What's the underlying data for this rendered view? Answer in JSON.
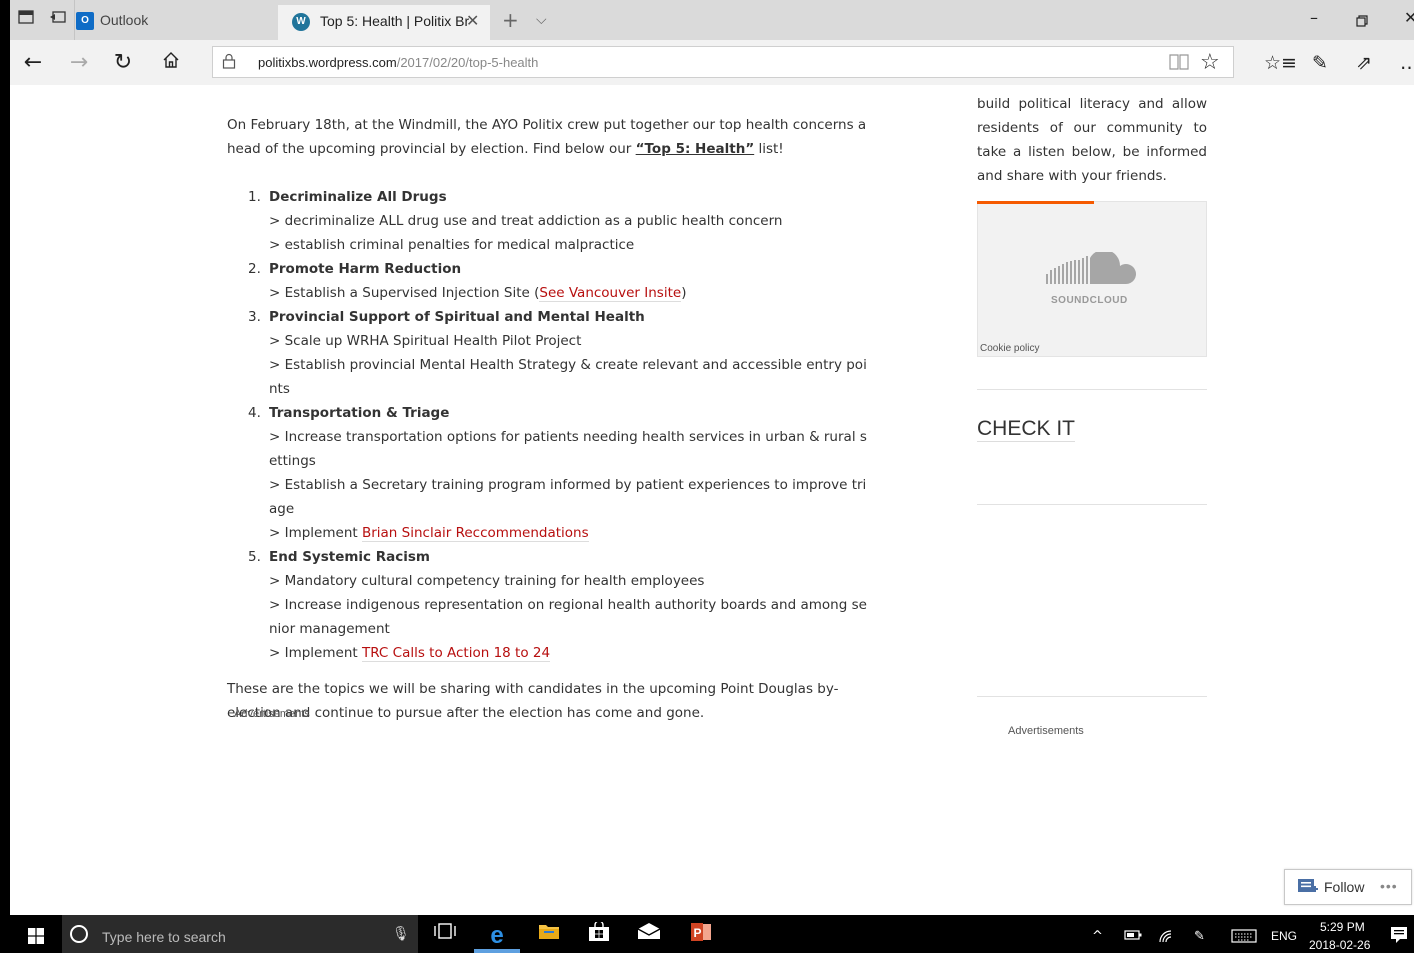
{
  "browser": {
    "tabs": [
      {
        "label": "Outlook"
      },
      {
        "label": "Top 5: Health | Politix Br",
        "active": true
      }
    ],
    "url": {
      "host": "politixbs.wordpress.com",
      "path": "/2017/02/20/top-5-health"
    },
    "icons": {
      "tab_manager": "tabs-aside-icon",
      "back_tabs": "show-tabs-icon",
      "new_tab": "+",
      "tab_dropdown": "chevron-down-icon",
      "minimize": "–",
      "restore": "❐",
      "close": "✕",
      "back": "←",
      "forward": "→",
      "refresh": "↻",
      "home": "⌂",
      "favorite": "☆",
      "favorites_hub": "☆≡",
      "notes": "✎",
      "share": "⇗",
      "more": "…"
    }
  },
  "article": {
    "intro_pre": "On February 18th, at the Windmill, the AYO Politix crew put together our top health concerns ahead of the upcoming provincial by election. Find below our ",
    "intro_link": "“Top 5: Health”",
    "intro_post": " list!",
    "items": [
      {
        "num": "1.",
        "heading": "Decriminalize All Drugs",
        "lines": [
          {
            "text": "> decriminalize ALL drug use and treat addiction as a public health concern"
          },
          {
            "text": "> establish criminal penalties for medical malpractice"
          }
        ]
      },
      {
        "num": "2.",
        "heading": "Promote Harm Reduction",
        "lines": [
          {
            "pre": "> Establish a Supervised Injection Site (",
            "link": "See Vancouver Insite",
            "post": ")"
          }
        ]
      },
      {
        "num": "3.",
        "heading": "Provincial Support of Spiritual and Mental Health",
        "lines": [
          {
            "text": "> Scale up WRHA Spiritual Health Pilot Project"
          },
          {
            "text": "> Establish provincial Mental Health Strategy & create relevant and accessible entry points"
          }
        ]
      },
      {
        "num": "4.",
        "heading": "Transportation & Triage",
        "lines": [
          {
            "text": "> Increase transportation options for patients needing health services in urban & rural settings"
          },
          {
            "text": "> Establish a Secretary training program informed by patient experiences to improve triage"
          },
          {
            "pre": "> Implement ",
            "link": "Brian Sinclair Reccommendations",
            "post": ""
          }
        ]
      },
      {
        "num": "5.",
        "heading": "End Systemic Racism",
        "lines": [
          {
            "text": "> Mandatory cultural competency training for health employees"
          },
          {
            "text": "> Increase indigenous representation on regional health authority boards and among senior management"
          },
          {
            "pre": "> Implement ",
            "link": "TRC Calls to Action 18 to 24",
            "post": ""
          }
        ]
      }
    ],
    "outro": "These are the topics we will be sharing with candidates in the upcoming Point Douglas by-election and continue to pursue after the election has come and gone.",
    "ads_label": "Advertisements"
  },
  "sidebar": {
    "text": "build political literacy and allow residents of our community to take a listen below, be informed and share with your friends.",
    "soundcloud": {
      "name": "SOUNDCLOUD",
      "cookie": "Cookie policy",
      "accent": "#f55a00"
    },
    "heading": "CHECK IT",
    "ads_label": "Advertisements"
  },
  "follow": {
    "label": "Follow",
    "more": "•••"
  },
  "taskbar": {
    "search_placeholder": "Type here to search",
    "lang": "ENG",
    "time": "5:29 PM",
    "date": "2018-02-26"
  }
}
